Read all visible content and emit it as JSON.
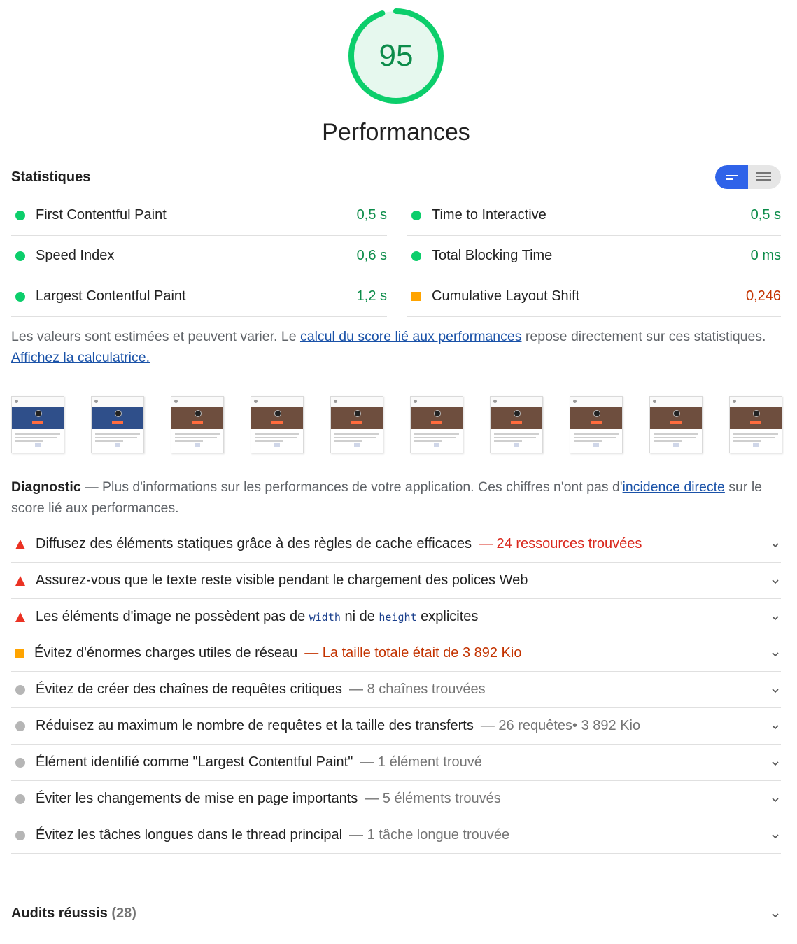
{
  "gauge": {
    "score": "95",
    "title": "Performances",
    "color": "#0cce6b",
    "fraction": 0.95
  },
  "metrics": {
    "title": "Statistiques",
    "left": [
      {
        "label": "First Contentful Paint",
        "value": "0,5 s",
        "status": "pass"
      },
      {
        "label": "Speed Index",
        "value": "0,6 s",
        "status": "pass"
      },
      {
        "label": "Largest Contentful Paint",
        "value": "1,2 s",
        "status": "pass"
      }
    ],
    "right": [
      {
        "label": "Time to Interactive",
        "value": "0,5 s",
        "status": "pass"
      },
      {
        "label": "Total Blocking Time",
        "value": "0 ms",
        "status": "pass"
      },
      {
        "label": "Cumulative Layout Shift",
        "value": "0,246",
        "status": "average"
      }
    ],
    "note_prefix": "Les valeurs sont estimées et peuvent varier. Le ",
    "note_link": "calcul du score lié aux performances",
    "note_middle": " repose directement sur ces statistiques. ",
    "note_link2": "Affichez la calculatrice."
  },
  "filmstrip": {
    "frame_count": 10,
    "hero_styles": [
      "blue",
      "blue",
      "brown",
      "brown",
      "brown",
      "brown",
      "brown",
      "brown",
      "brown",
      "brown"
    ]
  },
  "diagnostics": {
    "title": "Diagnostic",
    "intro_prefix": " — Plus d'informations sur les performances de votre application. Ces chiffres n'ont pas d'",
    "intro_link": "incidence directe",
    "intro_suffix": " sur le score lié aux performances.",
    "audits": [
      {
        "icon": "triangle",
        "text": "Diffusez des éléments statiques grâce à des règles de cache efficaces",
        "display": "— 24 ressources trouvées",
        "display_color": "red"
      },
      {
        "icon": "triangle",
        "text": "Assurez-vous que le texte reste visible pendant le chargement des polices Web",
        "display": "",
        "display_color": "red"
      },
      {
        "icon": "triangle",
        "text_a": "Les éléments d'image ne possèdent pas de ",
        "code_a": "width",
        "text_b": " ni de ",
        "code_b": "height",
        "text_c": " explicites"
      },
      {
        "icon": "square",
        "text": "Évitez d'énormes charges utiles de réseau",
        "display": "— La taille totale était de 3 892 Kio",
        "display_color": "orange"
      },
      {
        "icon": "circle",
        "text": "Évitez de créer des chaînes de requêtes critiques",
        "display": "— 8 chaînes trouvées",
        "display_color": "gray"
      },
      {
        "icon": "circle",
        "text": "Réduisez au maximum le nombre de requêtes et la taille des transferts",
        "display": "— 26 requêtes• 3 892 Kio",
        "display_color": "gray"
      },
      {
        "icon": "circle",
        "text": "Élément identifié comme \"Largest Contentful Paint\"",
        "display": "— 1 élément trouvé",
        "display_color": "gray"
      },
      {
        "icon": "circle",
        "text": "Éviter les changements de mise en page importants",
        "display": "— 5 éléments trouvés",
        "display_color": "gray"
      },
      {
        "icon": "circle",
        "text": "Évitez les tâches longues dans le thread principal",
        "display": "— 1 tâche longue trouvée",
        "display_color": "gray"
      }
    ]
  },
  "passed": {
    "label": "Audits réussis",
    "count": "(28)"
  },
  "colors": {
    "pass": "#0cce6b",
    "average": "#ffa400",
    "fail": "#eb3223",
    "link": "#1a52a8",
    "toggle_active": "#2f63e9"
  }
}
